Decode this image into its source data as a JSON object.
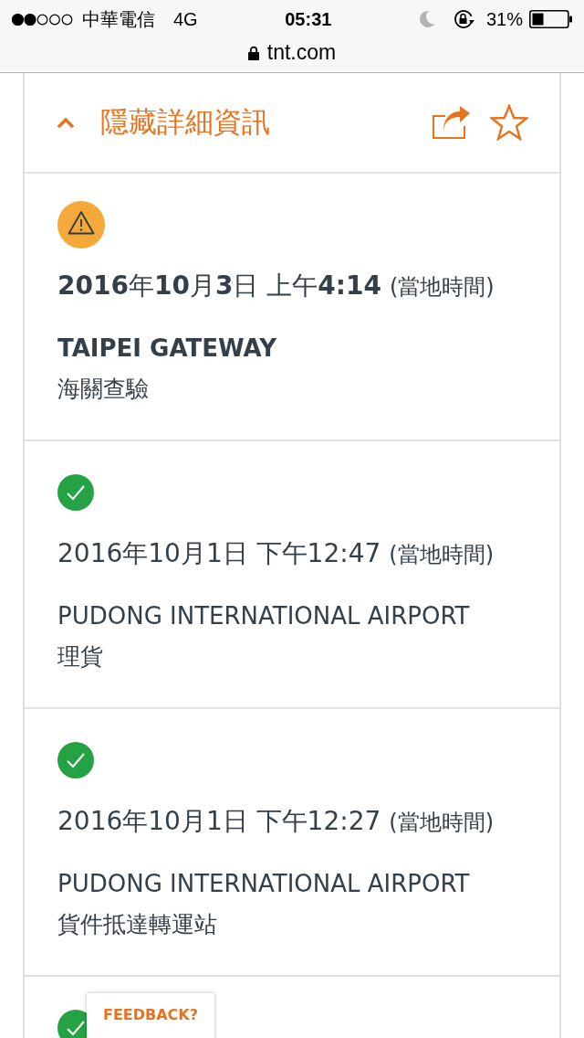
{
  "status_bar": {
    "carrier": "中華電信",
    "network": "4G",
    "time": "05:31",
    "battery": "31%"
  },
  "address_bar": {
    "url": "tnt.com"
  },
  "details_header": {
    "label": "隱藏詳細資訊",
    "expanded": true
  },
  "events": [
    {
      "kind": "warning",
      "datetime": "**2016**年**10**月**3**日 上午**4:14**",
      "timezone_note": "(當地時間)",
      "location": "TAIPEI GATEWAY",
      "description": "海關查驗"
    },
    {
      "kind": "done",
      "datetime": "2016年10月1日 下午12:47",
      "timezone_note": "(當地時間)",
      "location": "PUDONG INTERNATIONAL AIRPORT",
      "description": "理貨"
    },
    {
      "kind": "done",
      "datetime": "2016年10月1日 下午12:27",
      "timezone_note": "(當地時間)",
      "location": "PUDONG INTERNATIONAL AIRPORT",
      "description": "貨件抵達轉運站"
    },
    {
      "kind": "done"
    }
  ],
  "feedback": {
    "label": "FEEDBACK?"
  }
}
